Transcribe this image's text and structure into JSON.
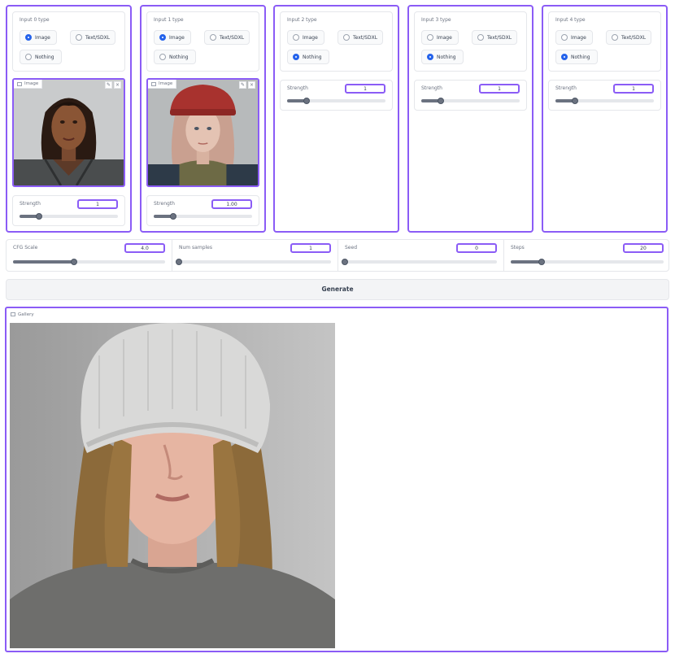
{
  "columns": [
    {
      "type_label": "Input 0 type",
      "options": [
        "Image",
        "Text/SDXL",
        "Nothing"
      ],
      "selected": 0,
      "has_image": true,
      "image_label": "Image",
      "strength_label": "Strength",
      "strength_value": "1",
      "strength_fraction": 0.2
    },
    {
      "type_label": "Input 1 type",
      "options": [
        "Image",
        "Text/SDXL",
        "Nothing"
      ],
      "selected": 0,
      "has_image": true,
      "image_label": "Image",
      "strength_label": "Strength",
      "strength_value": "1.00",
      "strength_fraction": 0.2
    },
    {
      "type_label": "Input 2 type",
      "options": [
        "Image",
        "Text/SDXL",
        "Nothing"
      ],
      "selected": 2,
      "has_image": false,
      "strength_label": "Strength",
      "strength_value": "1",
      "strength_fraction": 0.2
    },
    {
      "type_label": "Input 3 type",
      "options": [
        "Image",
        "Text/SDXL",
        "Nothing"
      ],
      "selected": 2,
      "has_image": false,
      "strength_label": "Strength",
      "strength_value": "1",
      "strength_fraction": 0.2
    },
    {
      "type_label": "Input 4 type",
      "options": [
        "Image",
        "Text/SDXL",
        "Nothing"
      ],
      "selected": 2,
      "has_image": false,
      "strength_label": "Strength",
      "strength_value": "1",
      "strength_fraction": 0.2
    }
  ],
  "settings": [
    {
      "label": "CFG Scale",
      "value": "4.0",
      "fraction": 0.4
    },
    {
      "label": "Num samples",
      "value": "1",
      "fraction": 0.0
    },
    {
      "label": "Seed",
      "value": "0",
      "fraction": 0.0
    },
    {
      "label": "Steps",
      "value": "20",
      "fraction": 0.2
    }
  ],
  "generate_label": "Generate",
  "gallery_label": "Gallery",
  "colors": {
    "accent": "#8b5cf6",
    "radio_selected": "#2563eb",
    "slider": "#6b7280"
  },
  "icons": {
    "image_label_icon": "image-icon",
    "edit_icon": "pencil-icon",
    "close_icon": "close-icon",
    "gallery_icon": "image-icon"
  }
}
